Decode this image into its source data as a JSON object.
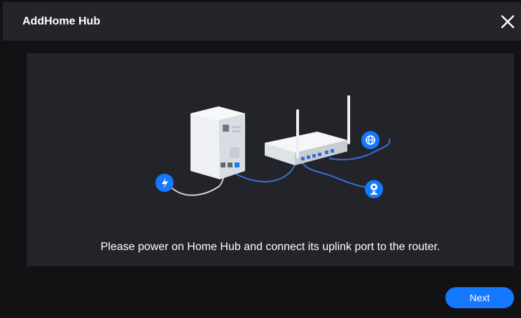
{
  "dialog": {
    "title": "AddHome Hub",
    "close_icon": "close-icon",
    "instruction": "Please power on Home Hub and connect its uplink port to the router.",
    "next_label": "Next"
  },
  "illustration": {
    "icons": [
      "power-icon",
      "globe-icon",
      "camera-icon"
    ],
    "accent_color": "#1677ff",
    "cable_color": "#3b6fd6"
  }
}
